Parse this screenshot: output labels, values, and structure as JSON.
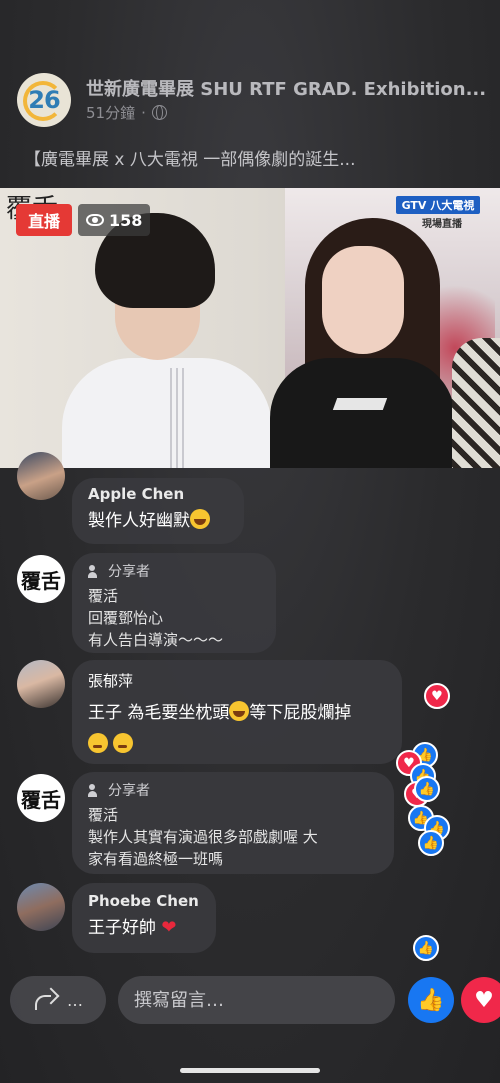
{
  "header": {
    "page_name": "世新廣電畢展 SHU RTF GRAD. Exhibition...",
    "avatar_number": "26",
    "time_ago": "51分鐘",
    "dot": "·",
    "post_title": "【廣電畢展 x 八大電視 一部偶像劇的誕生..."
  },
  "video": {
    "live_label": "直播",
    "viewer_count": "158",
    "channel_prefix": "GTV",
    "channel_name": "八大電視",
    "channel_sub": "現場直播",
    "corner_logo": "覆舌"
  },
  "comments": [
    {
      "name": "Apple Chen",
      "text": "製作人好幽默"
    },
    {
      "role": "分享者",
      "name": "覆活",
      "reply_to": "回覆鄧怡心",
      "text": "有人告白導演～～～",
      "logo": "覆舌"
    },
    {
      "name": "張郁萍",
      "text": "王子 為毛要坐枕頭",
      "text2": "等下屁股爛掉"
    },
    {
      "role": "分享者",
      "name": "覆活",
      "text_line1": "製作人其實有演過很多部戲劇喔 大",
      "text_line2": "家有看過終極一班嗎",
      "logo": "覆舌"
    },
    {
      "name": "Phoebe Chen",
      "text": "王子好帥"
    }
  ],
  "bottom_bar": {
    "share_more": "…",
    "comment_placeholder": "撰寫留言…"
  },
  "colors": {
    "live_red": "#e53935",
    "like_blue": "#1877f2",
    "love_red": "#f0284a"
  }
}
